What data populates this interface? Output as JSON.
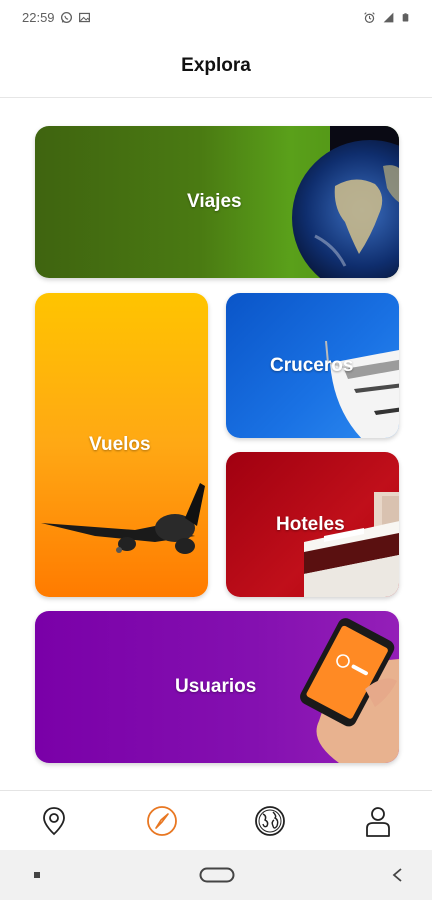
{
  "status_bar": {
    "time": "22:59",
    "icons": [
      "whatsapp-icon",
      "image-icon",
      "alarm-icon",
      "signal-icon",
      "battery-icon"
    ]
  },
  "header": {
    "title": "Explora"
  },
  "cards": {
    "viajes": {
      "label": "Viajes",
      "image": "earth-globe"
    },
    "vuelos": {
      "label": "Vuelos",
      "image": "airplane"
    },
    "cruceros": {
      "label": "Cruceros",
      "image": "cruise-ship"
    },
    "hoteles": {
      "label": "Hoteles",
      "image": "hotel-bed"
    },
    "usuarios": {
      "label": "Usuarios",
      "image": "hand-holding-phone"
    }
  },
  "bottom_nav": {
    "items": [
      {
        "icon": "location-pin-icon",
        "active": false
      },
      {
        "icon": "compass-icon",
        "active": true
      },
      {
        "icon": "globe-icon",
        "active": false
      },
      {
        "icon": "user-icon",
        "active": false
      }
    ],
    "active_color": "#e87722",
    "inactive_color": "#222222"
  },
  "system_nav": {
    "icons": [
      "recents-icon",
      "home-icon",
      "back-icon"
    ]
  }
}
